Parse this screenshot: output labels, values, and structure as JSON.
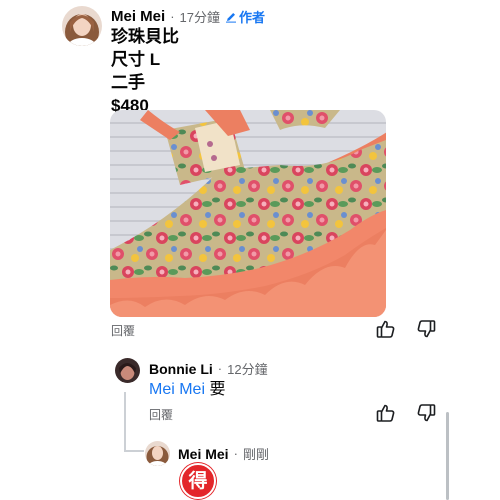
{
  "colors": {
    "accent": "#1877f2",
    "secondary_text": "#65676b",
    "dress_peach": "#f08a6c"
  },
  "comment_main": {
    "author": "Mei Mei",
    "separator": "·",
    "time": "17分鐘",
    "badge_icon": "pencil-icon",
    "badge_label": "作者",
    "lines": [
      "珍珠貝比",
      "尺寸 L",
      "二手",
      "$480"
    ],
    "photo_icon": "photo-floral-dress",
    "reply_label": "回覆",
    "like_icon": "thumbs-up-icon",
    "dislike_icon": "thumbs-down-icon"
  },
  "comment_reply1": {
    "author": "Bonnie Li",
    "separator": "·",
    "time": "12分鐘",
    "mention": "Mei Mei",
    "text": "要",
    "reply_label": "回覆",
    "like_icon": "thumbs-up-icon",
    "dislike_icon": "thumbs-down-icon"
  },
  "comment_reply2": {
    "author": "Mei Mei",
    "separator": "·",
    "time": "剛剛",
    "sticker_text": "得"
  }
}
